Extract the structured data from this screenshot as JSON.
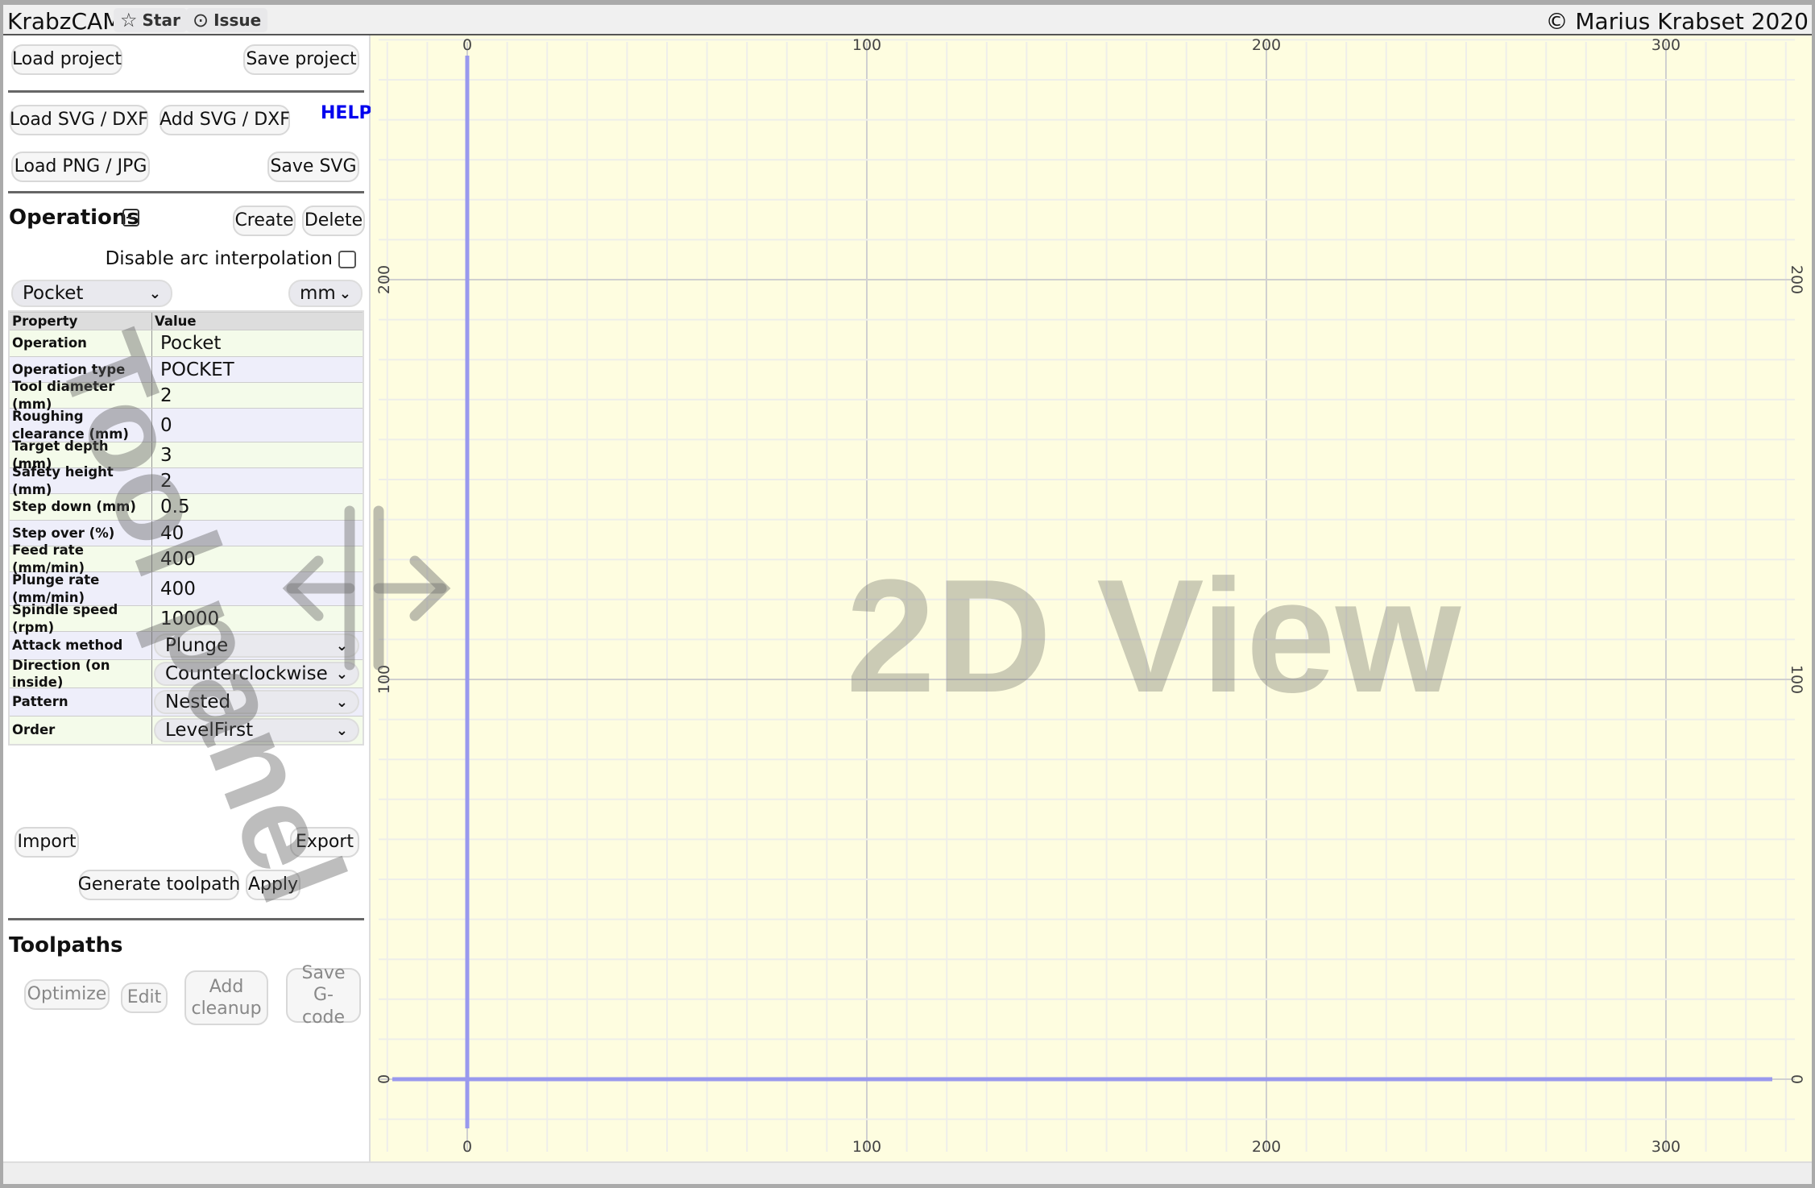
{
  "header": {
    "title": "KrabzCAM",
    "star_label": "Star",
    "issue_label": "Issue",
    "copyright": "© Marius Krabset 2020"
  },
  "panel": {
    "load_project": "Load project",
    "save_project": "Save project",
    "load_svg": "Load SVG / DXF",
    "add_svg": "Add SVG / DXF",
    "help": "HELP",
    "load_png": "Load PNG / JPG",
    "save_svg": "Save SVG",
    "operations_title": "Operations",
    "create": "Create",
    "delete": "Delete",
    "disable_arc": "Disable arc interpolation",
    "disable_arc_checked": false,
    "operation_select": "Pocket",
    "unit_select": "mm",
    "table": {
      "headers": [
        "Property",
        "Value"
      ],
      "rows": [
        {
          "label": "Operation",
          "value": "Pocket",
          "kind": "text"
        },
        {
          "label": "Operation type",
          "value": "POCKET",
          "kind": "text"
        },
        {
          "label": "Tool diameter (mm)",
          "value": "2",
          "kind": "input"
        },
        {
          "label": "Roughing clearance (mm)",
          "value": "0",
          "kind": "input"
        },
        {
          "label": "Target depth (mm)",
          "value": "3",
          "kind": "input"
        },
        {
          "label": "Safety height (mm)",
          "value": "2",
          "kind": "input"
        },
        {
          "label": "Step down (mm)",
          "value": "0.5",
          "kind": "input"
        },
        {
          "label": "Step over (%)",
          "value": "40",
          "kind": "input"
        },
        {
          "label": "Feed rate (mm/min)",
          "value": "400",
          "kind": "input"
        },
        {
          "label": "Plunge rate (mm/min)",
          "value": "400",
          "kind": "input"
        },
        {
          "label": "Spindle speed (rpm)",
          "value": "10000",
          "kind": "input"
        },
        {
          "label": "Attack method",
          "value": "Plunge",
          "kind": "select"
        },
        {
          "label": "Direction (on inside)",
          "value": "Counterclockwise",
          "kind": "select"
        },
        {
          "label": "Pattern",
          "value": "Nested",
          "kind": "select"
        },
        {
          "label": "Order",
          "value": "LevelFirst",
          "kind": "select"
        }
      ]
    },
    "import": "Import",
    "export": "Export",
    "generate": "Generate toolpath",
    "apply": "Apply",
    "toolpaths_title": "Toolpaths",
    "optimize": "Optimize",
    "edit": "Edit",
    "add_cleanup": "Add cleanup",
    "save_gcode": "Save G-code"
  },
  "view": {
    "x_ticks": [
      0,
      100,
      200,
      300
    ],
    "y_ticks": [
      0,
      100,
      200
    ],
    "axis_color": "#9999ee",
    "background": "#fefde0"
  },
  "overlays": {
    "tool_panel": "Tool panel",
    "view_2d": "2D View"
  },
  "colors": {
    "help_link": "#0000ee"
  }
}
